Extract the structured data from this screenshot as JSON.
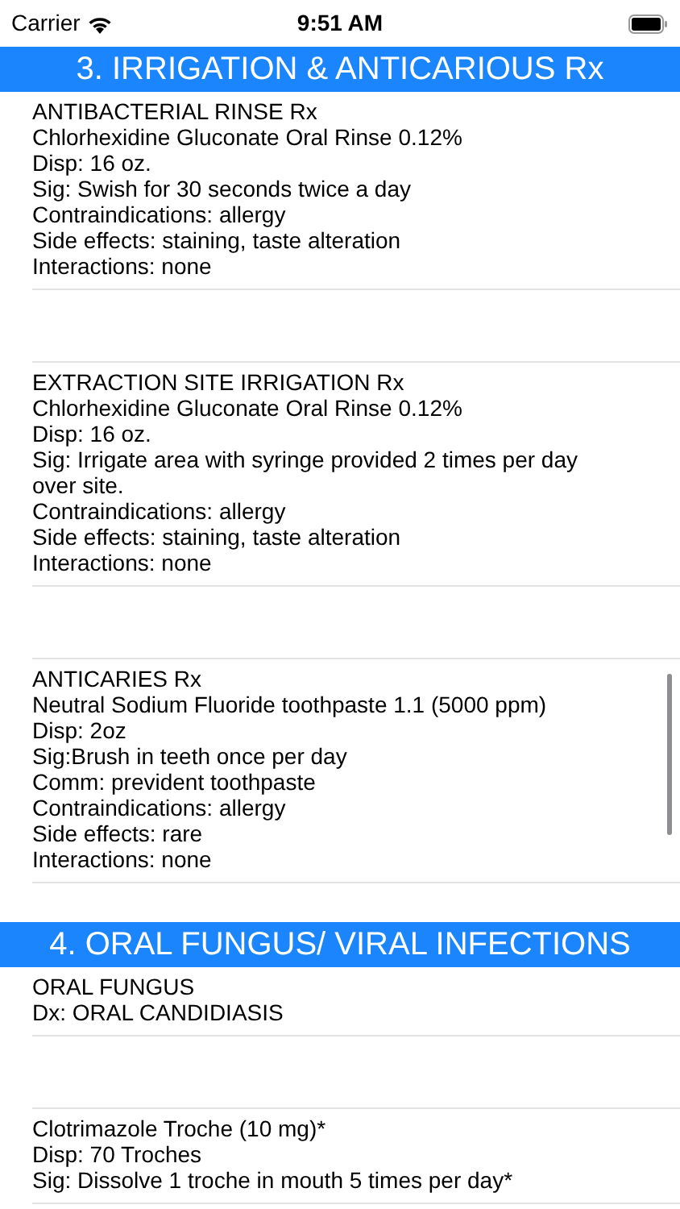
{
  "status_bar": {
    "carrier": "Carrier",
    "time": "9:51 AM"
  },
  "sections": [
    {
      "title": "3. IRRIGATION & ANTICARIOUS Rx",
      "rows": [
        {
          "kind": "entry",
          "lines": [
            "ANTIBACTERIAL RINSE Rx",
            "Chlorhexidine Gluconate Oral Rinse 0.12%",
            "Disp: 16 oz.",
            "Sig: Swish for 30 seconds twice a day",
            "Contraindications: allergy",
            "Side effects: staining, taste alteration",
            "Interactions: none"
          ]
        },
        {
          "kind": "spacer"
        },
        {
          "kind": "entry",
          "lines": [
            "EXTRACTION SITE IRRIGATION Rx",
            "Chlorhexidine Gluconate Oral Rinse 0.12%",
            "Disp: 16 oz.",
            "Sig: Irrigate area with syringe provided 2 times per day over site.",
            "Contraindications: allergy",
            "Side effects: staining, taste alteration",
            "Interactions: none"
          ]
        },
        {
          "kind": "spacer"
        },
        {
          "kind": "entry",
          "lines": [
            "ANTICARIES Rx",
            "Neutral Sodium Fluoride toothpaste 1.1 (5000 ppm)",
            "Disp: 2oz",
            "Sig:Brush in teeth once per day",
            "Comm: prevident toothpaste",
            "Contraindications: allergy",
            "Side effects: rare",
            "Interactions: none"
          ]
        }
      ]
    },
    {
      "title": "4. ORAL FUNGUS/ VIRAL INFECTIONS",
      "rows": [
        {
          "kind": "entry",
          "lines": [
            "ORAL FUNGUS",
            "Dx: ORAL CANDIDIASIS"
          ]
        },
        {
          "kind": "spacer"
        },
        {
          "kind": "entry",
          "lines": [
            "Clotrimazole Troche (10 mg)*",
            "Disp: 70 Troches",
            "Sig: Dissolve 1 troche in mouth 5 times per day*"
          ]
        }
      ]
    }
  ]
}
